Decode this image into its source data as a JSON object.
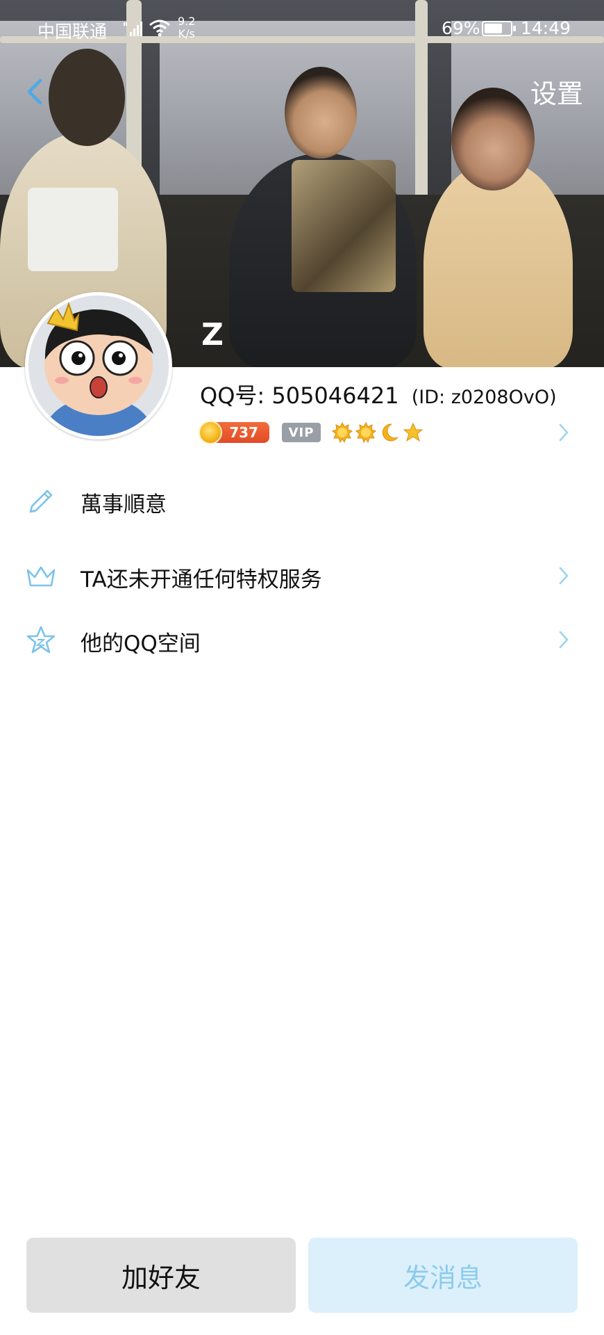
{
  "status_bar": {
    "carrier": "中国联通",
    "net_speed_value": "9.2",
    "net_speed_unit": "K/s",
    "battery_percent": "69%",
    "battery_level": 0.69,
    "time": "14:49"
  },
  "header": {
    "back_icon": "chevron-left-icon",
    "settings_label": "设置"
  },
  "profile": {
    "nickname": "Z",
    "qq_label": "QQ号:",
    "qq_number": "505046421",
    "qid": "(ID:  z0208OvO)",
    "coin_count": "737",
    "vip_label": "VIP",
    "level_icons": [
      "sun-icon",
      "sun-icon",
      "moon-icon",
      "star-icon"
    ]
  },
  "details": [
    {
      "icon": "pencil-icon",
      "label": "萬事順意",
      "has_arrow": false
    },
    {
      "icon": "crown-icon",
      "label": "TA还未开通任何特权服务",
      "has_arrow": true
    },
    {
      "icon": "star-outline-icon",
      "label": "他的QQ空间",
      "has_arrow": true
    }
  ],
  "buttons": {
    "add_friend": "加好友",
    "send_message": "发消息"
  },
  "colors": {
    "accent": "#7cc3ea",
    "message_button_bg": "#dcf0fb",
    "message_button_text": "#8ccbed",
    "add_button_bg": "#e0e0e0",
    "coin_badge": "#e8552c",
    "vip_badge": "#9a9ea6"
  }
}
